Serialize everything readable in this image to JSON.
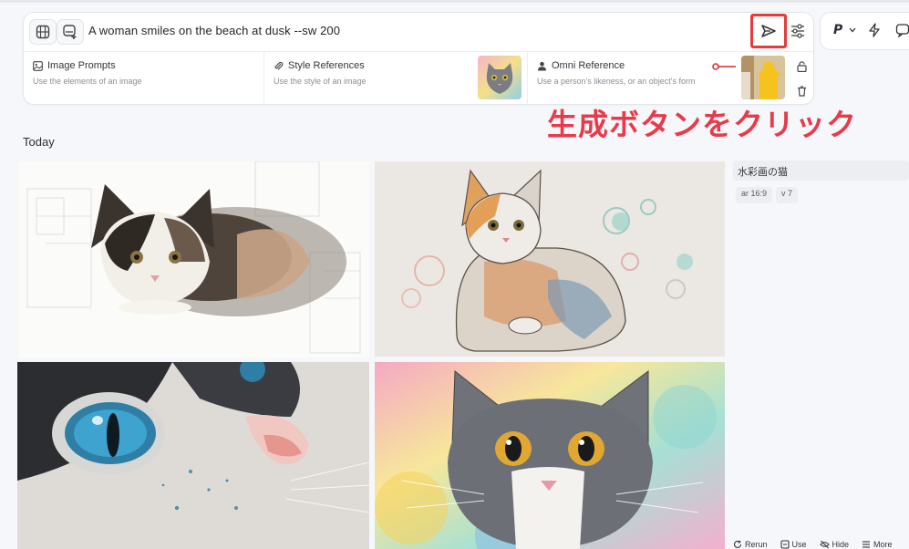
{
  "prompt": {
    "text": "A woman smiles on the beach at dusk --sw 200"
  },
  "references": [
    {
      "title": "Image Prompts",
      "subtitle": "Use the elements of an image",
      "icon": "image-icon"
    },
    {
      "title": "Style References",
      "subtitle": "Use the style of an image",
      "icon": "paperclip-icon"
    },
    {
      "title": "Omni Reference",
      "subtitle": "Use a person's likeness, or an object's form",
      "icon": "person-icon"
    }
  ],
  "toolbar": {
    "profile_label": "P"
  },
  "annotation": {
    "text": "生成ボタンをクリック",
    "color": "#e83a4a"
  },
  "feed": {
    "section_label": "Today",
    "job_title": "水彩画の猫",
    "chips": [
      "ar 16:9",
      "v 7"
    ],
    "actions": [
      "Rerun",
      "Use",
      "Hide",
      "More"
    ]
  },
  "colors": {
    "accent_red": "#e83a3a",
    "background": "#f6f7fa"
  }
}
